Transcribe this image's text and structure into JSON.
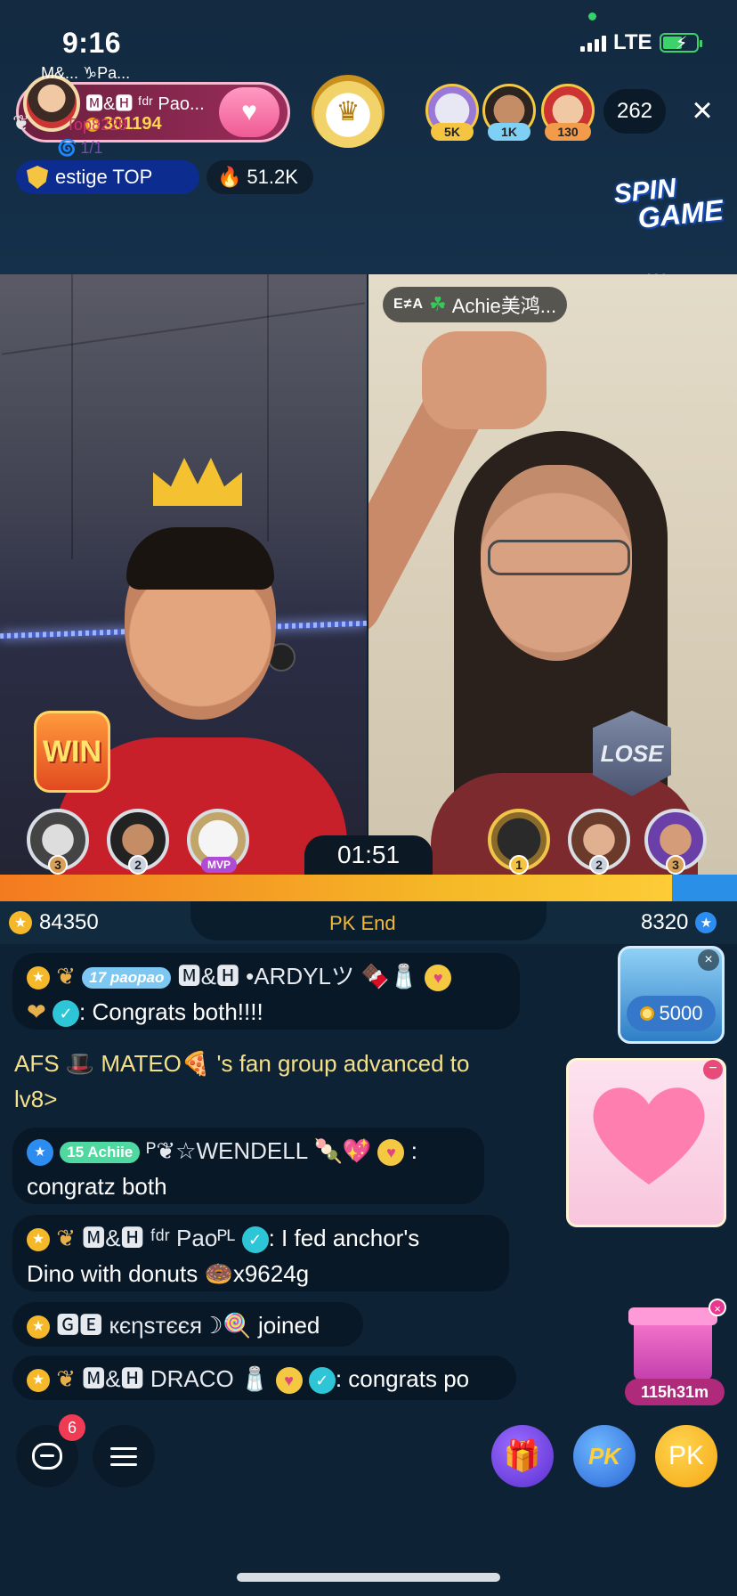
{
  "status_bar": {
    "time": "9:16",
    "network": "LTE"
  },
  "host": {
    "name": "🅼&🅷 ᶠᵈʳ Pao...",
    "coins": "301194"
  },
  "viewers": [
    {
      "badge": "5K",
      "badge_color": "#f5c542"
    },
    {
      "badge": "1K",
      "badge_color": "#7fd0f5"
    },
    {
      "badge": "130",
      "badge_color": "#f29b4b"
    }
  ],
  "viewer_count": "262",
  "close_icon": "×",
  "prestige_label": "estige TOP",
  "heat_value": "51.2K",
  "spin_game": {
    "line1": "SPIN",
    "line2": "GAME"
  },
  "left_video": {
    "result": "WIN",
    "ranks": [
      "3",
      "2"
    ],
    "mvp": "MVP"
  },
  "right_video": {
    "name_mark": "E≠A",
    "name": "Achie美鸿...",
    "result": "LOSE",
    "ranks": [
      "1",
      "2",
      "3"
    ]
  },
  "pk": {
    "timer": "01:51",
    "status": "PK End",
    "score_left": "84350",
    "score_right": "8320"
  },
  "chat": [
    {
      "level": "17",
      "tag": "paopao",
      "name": "🅼&🅷 •ARDYLツ",
      "message": ": Congrats both!!!!"
    },
    {
      "system": "AFS 🎩 MATEO🍕 's fan group advanced to lv8>"
    },
    {
      "level": "15",
      "tag": "Achiie",
      "name": "ᴾ❦☆WENDELL",
      "message": ":",
      "message2": "congratz both"
    },
    {
      "name": "🅼&🅷 ᶠᵈʳ Paoᴾᴸ",
      "message": ": I fed anchor's",
      "message2": "Dino with donuts 🍩x9624g"
    },
    {
      "name": "🅶🅴 кєηsтєєя☽🍭",
      "message": "joined"
    },
    {
      "name": "🅼&🅷 DRACO",
      "message": ": congrats po"
    }
  ],
  "gift_float": {
    "value": "5000"
  },
  "top_card": {
    "names": "M&... ♑Pa...",
    "label": "Top8228",
    "count": "1/1"
  },
  "gift_box": {
    "timer": "115h31m"
  },
  "bottom": {
    "notifications": "6",
    "pk_label": "PK",
    "pk_shield_label": "PK"
  }
}
